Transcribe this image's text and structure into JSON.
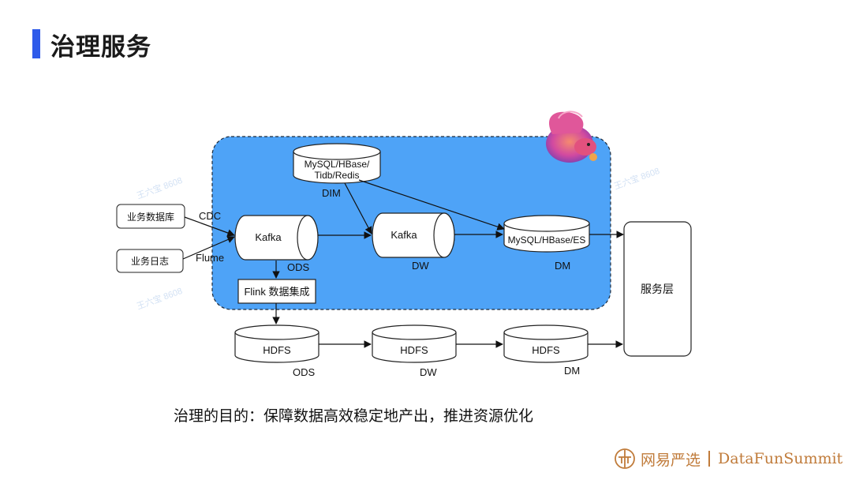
{
  "title": "治理服务",
  "caption": "治理的目的：保障数据高效稳定地产出，推进资源优化",
  "footer": {
    "brand": "网易严选",
    "partner": "DataFunSummit"
  },
  "colors": {
    "accent_bar": "#2f5bea",
    "region": "#4ea3f7",
    "footer": "#c07b3a"
  },
  "diagram": {
    "sources": {
      "db": "业务数据库",
      "log": "业务日志"
    },
    "edge_labels": {
      "cdc": "CDC",
      "flume": "Flume"
    },
    "nodes": {
      "dim_store": "MySQL/HBase/\nTidb/Redis",
      "dim_label": "DIM",
      "kafka_ods": "Kafka",
      "ods_label": "ODS",
      "kafka_dw": "Kafka",
      "dw_label": "DW",
      "dm_store": "MySQL/HBase/ES",
      "dm_label": "DM",
      "flink": "Flink 数据集成",
      "service": "服务层",
      "hdfs_ods": "HDFS",
      "hdfs_ods_label": "ODS",
      "hdfs_dw": "HDFS",
      "hdfs_dw_label": "DW",
      "hdfs_dm": "HDFS",
      "hdfs_dm_label": "DM"
    },
    "icons": {
      "flink_logo": "squirrel-logo-icon",
      "footer_logo": "yanxuan-logo-icon"
    }
  }
}
